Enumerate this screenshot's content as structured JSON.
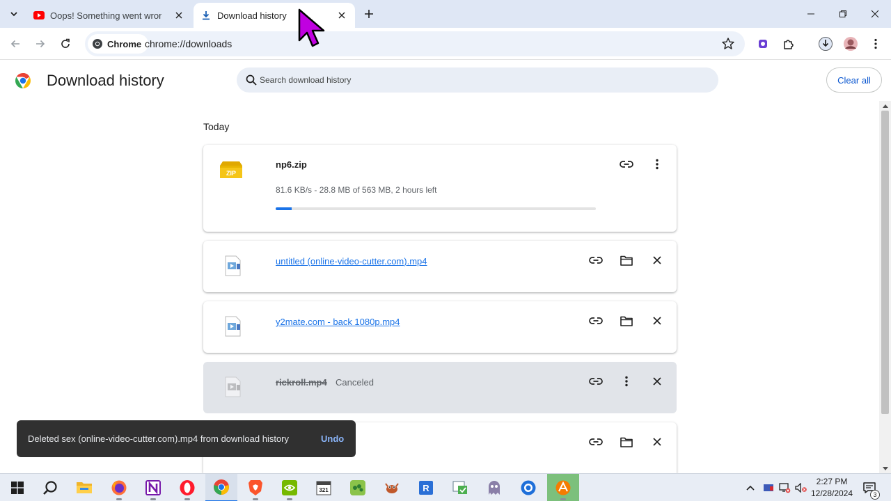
{
  "browser": {
    "tabs": [
      {
        "title": "Oops! Something went wrong",
        "favicon": "youtube-icon",
        "active": false
      },
      {
        "title": "Download history",
        "favicon": "download-icon",
        "active": true
      }
    ],
    "chip_label": "Chrome",
    "url": "chrome://downloads"
  },
  "page": {
    "title": "Download history",
    "search_placeholder": "Search download history",
    "clear_all_label": "Clear all",
    "section_date": "Today"
  },
  "downloads": [
    {
      "name": "np6.zip",
      "status": "81.6 KB/s - 28.8 MB of 563 MB, 2 hours left",
      "progress_fraction": 0.051,
      "icon": "zip-file-icon",
      "state": "in-progress"
    },
    {
      "name": "untitled (online-video-cutter.com).mp4",
      "icon": "video-file-icon",
      "state": "complete"
    },
    {
      "name": "y2mate.com - back 1080p.mp4",
      "icon": "video-file-icon",
      "state": "complete"
    },
    {
      "name": "rickroll.mp4",
      "tag": "Canceled",
      "icon": "video-file-icon",
      "state": "canceled"
    },
    {
      "name": "",
      "icon": "video-file-icon",
      "state": "complete"
    }
  ],
  "toast": {
    "message": "Deleted sex (online-video-cutter.com).mp4 from download history",
    "undo_label": "Undo"
  },
  "taskbar": {
    "time": "2:27 PM",
    "date": "12/28/2024",
    "notification_count": "3",
    "apps": [
      "start-icon",
      "search-icon",
      "file-explorer-icon",
      "firefox-icon",
      "onenote-icon",
      "opera-icon",
      "chrome-icon",
      "brave-icon",
      "nvidia-icon",
      "calendar-icon",
      "pea-icon",
      "crab-icon",
      "app-blue-icon",
      "app-green-icon",
      "ghost-icon",
      "app-shield-icon",
      "app-orange-icon"
    ]
  },
  "colors": {
    "accent": "#1a73e8",
    "tabstrip": "#dfe7f5",
    "toast_bg": "#303030",
    "undo": "#8ab4f8"
  }
}
